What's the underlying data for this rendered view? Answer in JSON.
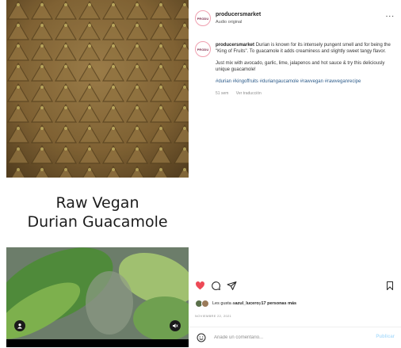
{
  "post": {
    "title_line1": "Raw Vegan",
    "title_line2": "Durian Guacamole"
  },
  "header": {
    "username": "producersmarket",
    "audio_label": "Audio original",
    "more_label": "..."
  },
  "caption": {
    "username": "producersmarket",
    "text1": "Durian is known for its intensely pungent smell and for being the \"King of Fruits\". To guacamole it adds creaminess and slightly sweet tangy flavor.",
    "text2": "Just mix with avocado, garlic, lime, jalapenos and hot sauce & try this deliciously unique guacamole!",
    "hashtags": "#durian #kingoffruits #duriangaucamole #rawvegan #rawveganrecipe",
    "time_ago": "51 sem",
    "translate": "Ver traducción"
  },
  "likes": {
    "prefix": "Les gusta a ",
    "user": "azul_lucero",
    "middle": " y ",
    "others": "17 personas más"
  },
  "date": "NOVIEMBRE 22, 2021",
  "comment": {
    "placeholder": "Añade un comentario...",
    "publish": "Publicar"
  },
  "colors": {
    "like_red": "#ed4956",
    "hashtag_blue": "#2c5b8a",
    "publish_disabled": "#b2dffc"
  },
  "icons": [
    "heart-icon",
    "comment-icon",
    "share-icon",
    "bookmark-icon",
    "emoji-icon",
    "user-tag-icon",
    "mute-icon"
  ]
}
